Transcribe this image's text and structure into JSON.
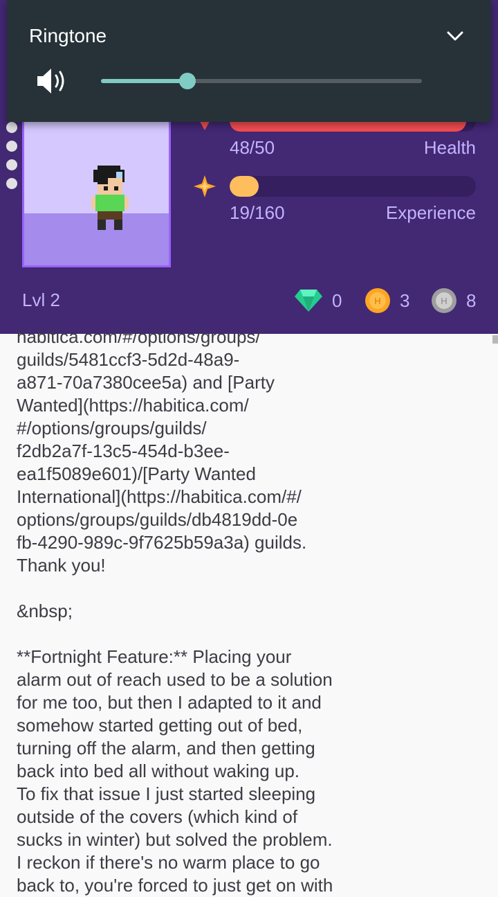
{
  "volume_panel": {
    "title": "Ringtone",
    "level": 0.27
  },
  "stats": {
    "health": {
      "text": "48/50",
      "label": "Health",
      "current": 48,
      "max": 50,
      "color": "#f74e52"
    },
    "experience": {
      "text": "19/160",
      "label": "Experience",
      "current": 19,
      "max": 160,
      "color": "#ffbe5d"
    }
  },
  "level_text": "Lvl 2",
  "currencies": {
    "gems": "0",
    "gold": "3",
    "silver": "8"
  },
  "content": {
    "text": "habitica.com/#/options/groups/\nguilds/5481ccf3-5d2d-48a9-\na871-70a7380cee5a) and [Party\nWanted](https://habitica.com/\n#/options/groups/guilds/\nf2db2a7f-13c5-454d-b3ee-\nea1f5089e601)/[Party Wanted\nInternational](https://habitica.com/#/\noptions/groups/guilds/db4819dd-0e\nfb-4290-989c-9f7625b59a3a) guilds.\nThank you!\n\n&nbsp;\n\n**Fortnight Feature:** Placing your\nalarm out of reach used to be a solution\nfor me too, but then I adapted to it and\nsomehow started getting out of bed,\nturning off the alarm, and then getting\nback into bed all without waking up.\nTo fix that issue I just started sleeping\noutside of the covers (which kind of\nsucks in winter) but solved the problem.\nI reckon if there's no warm place to go\nback to, you're forced to just get on with"
  },
  "colors": {
    "header_bg": "#432874",
    "overlay_bg": "#263238",
    "accent_teal": "#80cbc4"
  }
}
